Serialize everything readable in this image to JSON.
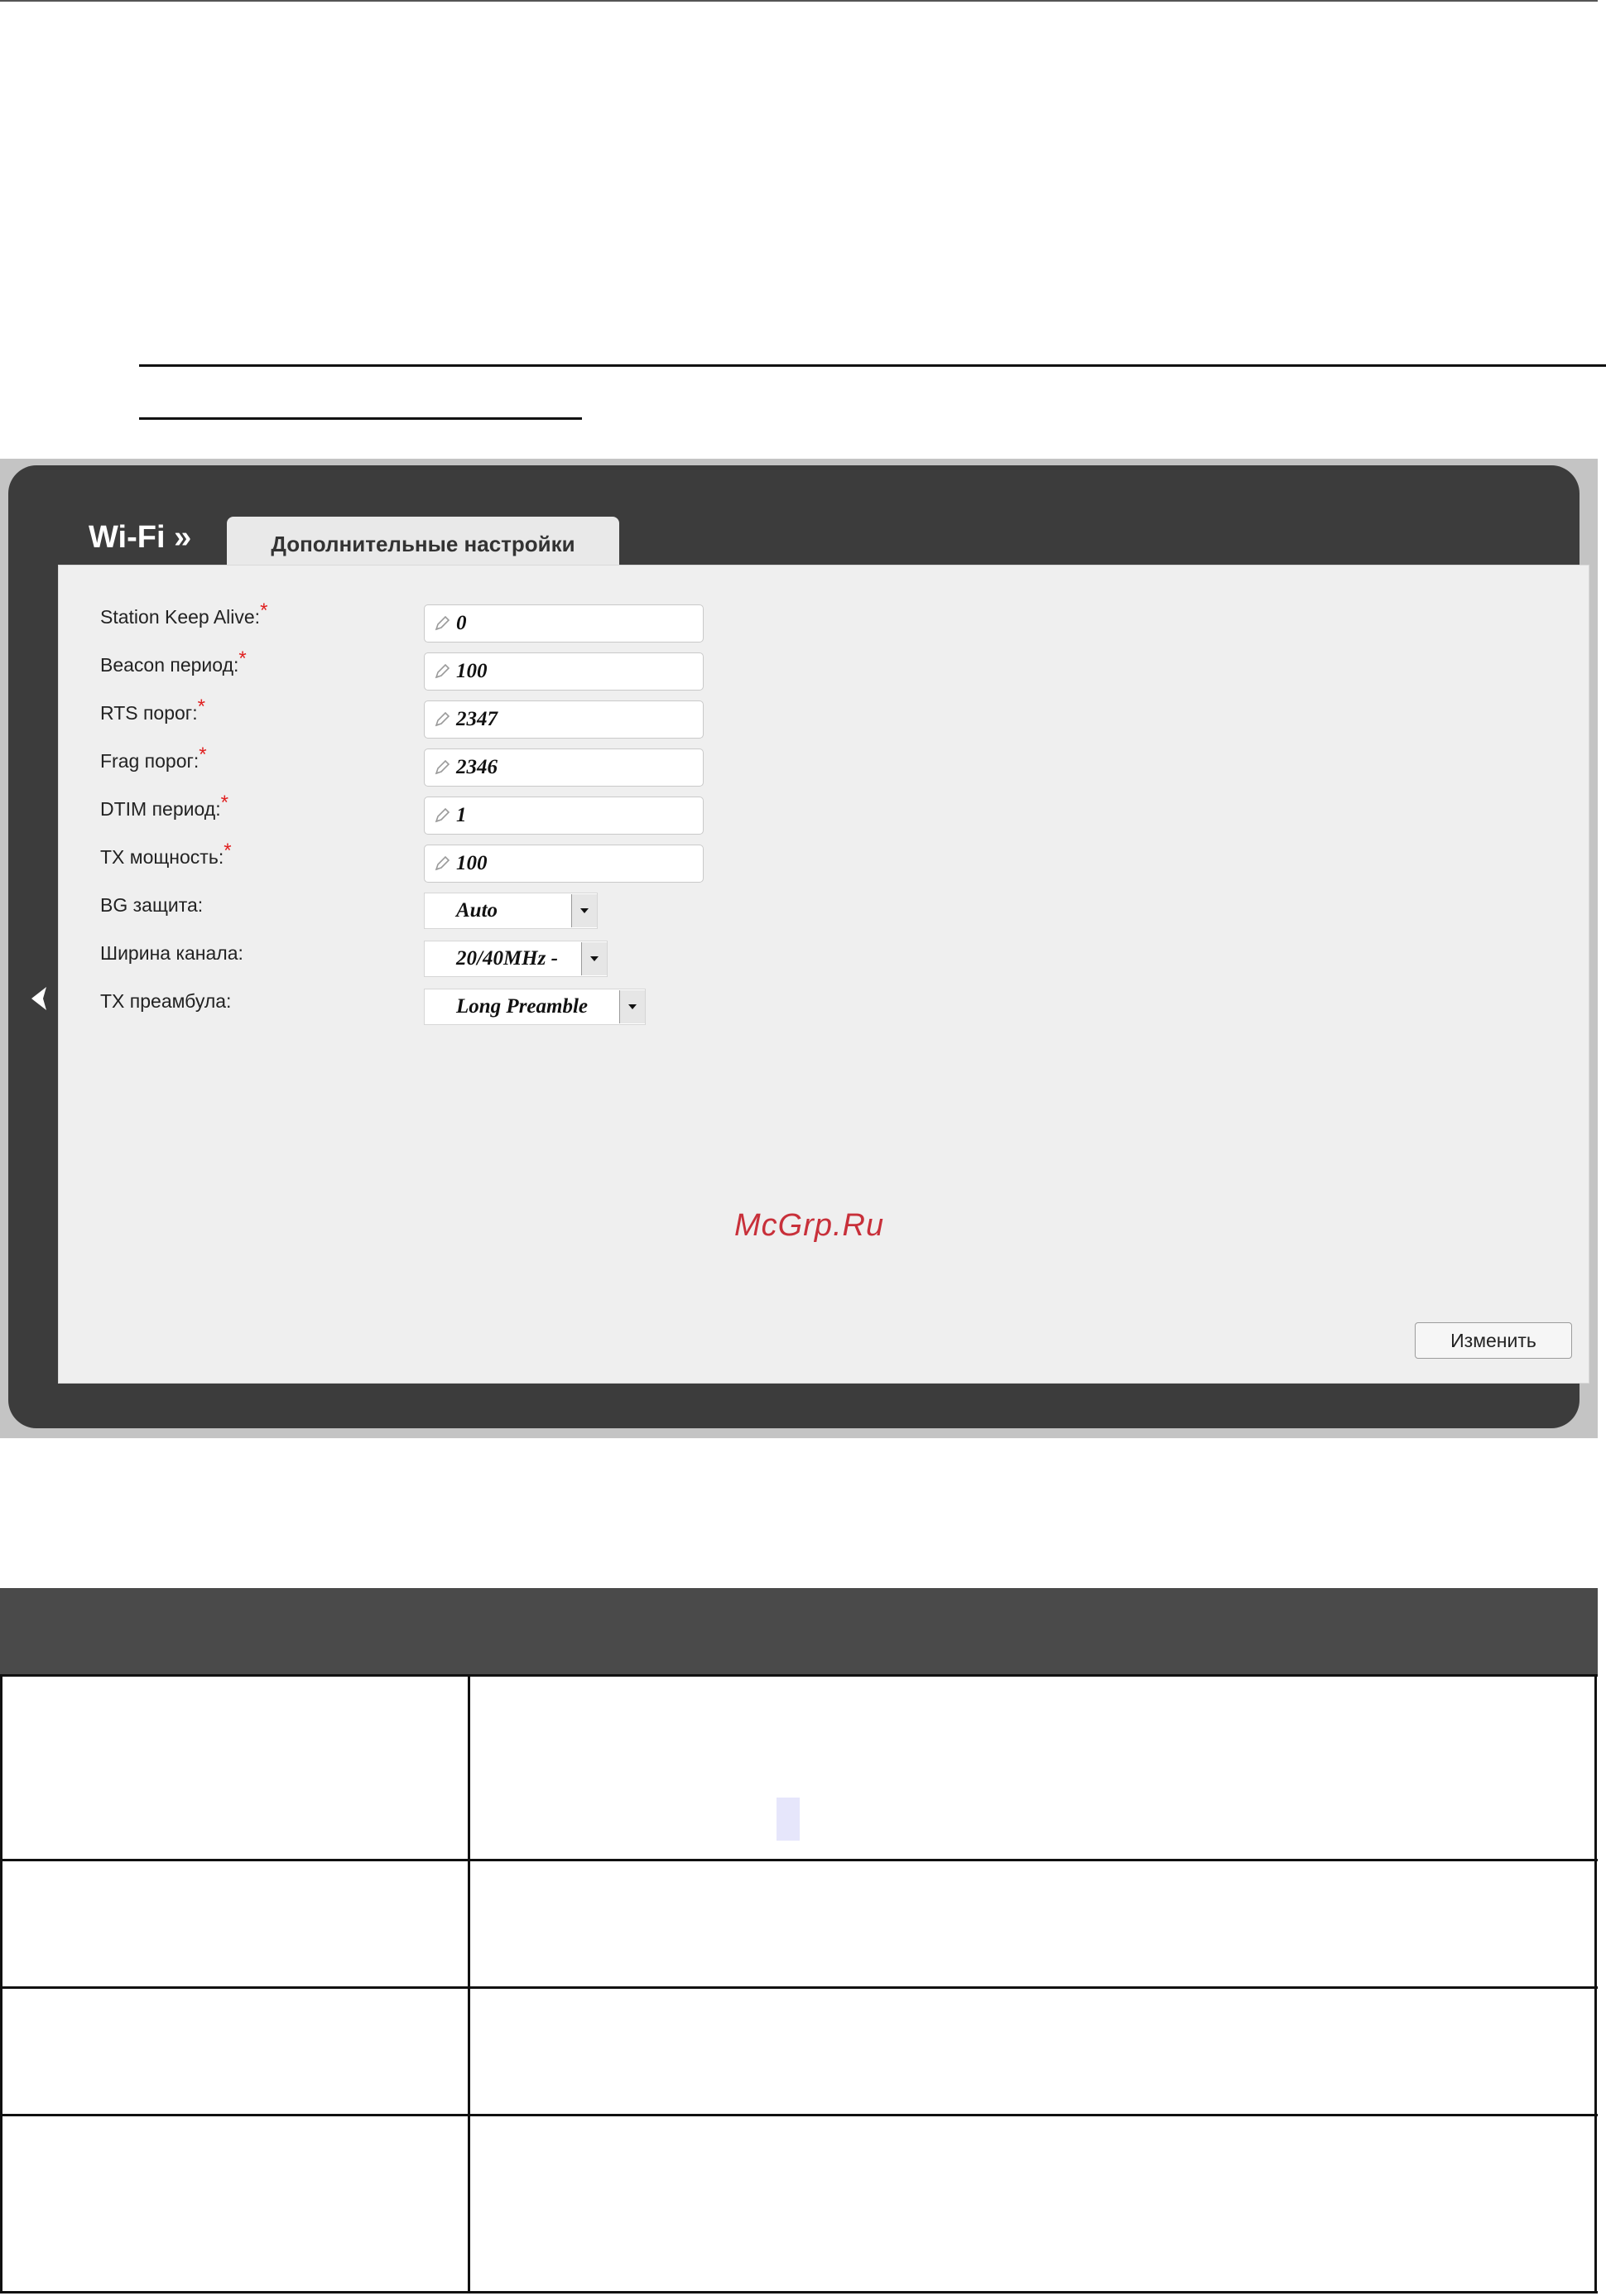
{
  "screenshot": {
    "breadcrumb": "Wi-Fi »",
    "tab_label": "Дополнительные настройки",
    "fields": [
      {
        "label": "Station Keep Alive:",
        "required_mark": "*",
        "value": "0"
      },
      {
        "label": "Beacon период:",
        "required_mark": "*",
        "value": "100"
      },
      {
        "label": "RTS порог:",
        "required_mark": "*",
        "value": "2347"
      },
      {
        "label": "Frag порог:",
        "required_mark": "*",
        "value": "2346"
      },
      {
        "label": "DTIM период:",
        "required_mark": "*",
        "value": "1"
      },
      {
        "label": "TX мощность:",
        "required_mark": "*",
        "value": "100"
      }
    ],
    "selects": [
      {
        "label": "BG защита:",
        "value": "Auto"
      },
      {
        "label": "Ширина канала:",
        "value": "20/40MHz -"
      },
      {
        "label": "TX преамбула:",
        "value": "Long Preamble"
      }
    ],
    "watermark": "McGrp.Ru",
    "submit_label": "Изменить"
  },
  "colors": {
    "frame": "#3c3c3c",
    "panel": "#efefef",
    "required": "#e02020",
    "watermark": "#c8303a",
    "table_header": "#4a4a4a"
  },
  "icons": [
    "pencil-icon",
    "chevron-down-icon",
    "chevron-left-icon"
  ]
}
